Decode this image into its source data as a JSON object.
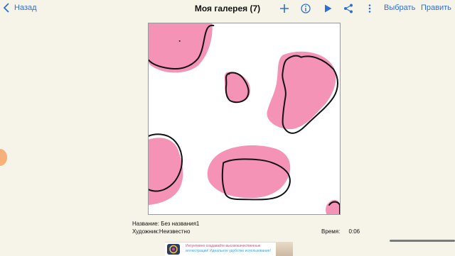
{
  "header": {
    "back_label": "Назад",
    "title": "Моя галерея (7)",
    "select_label": "Выбрать",
    "edit_label": "Править"
  },
  "artwork": {
    "name_label": "Название:",
    "name_value": "Без названия1",
    "artist_label": "Художник:",
    "artist_value": "Неизвестно",
    "time_label": "Время:",
    "time_value": "0:06"
  },
  "ad": {
    "line1": "Интуитивно создавайте высококачественные",
    "line2": "иллюстрации! Идеальное удобство использования!"
  },
  "colors": {
    "accent": "#2f6fd1",
    "pink": "#f593b6",
    "background": "#f6f3e8"
  },
  "icons": [
    "chevron-left",
    "plus",
    "info",
    "play",
    "share",
    "more-vertical"
  ]
}
